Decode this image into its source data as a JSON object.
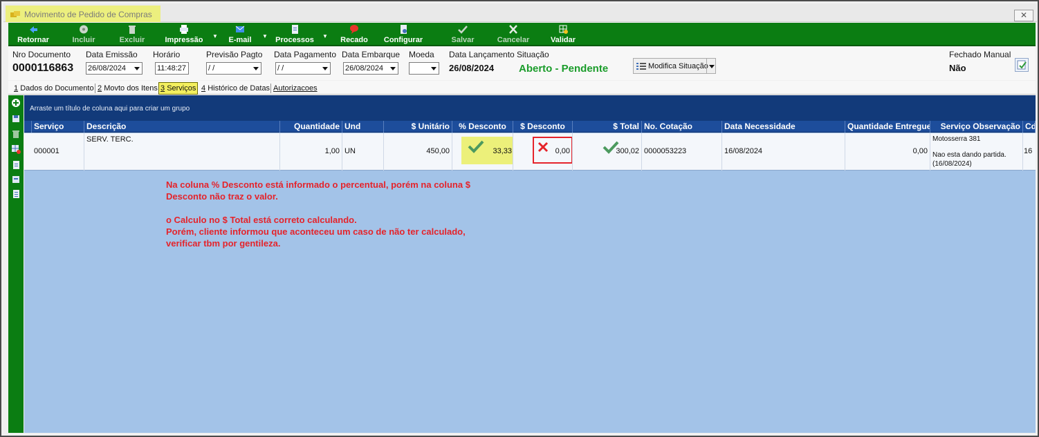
{
  "window": {
    "title": "Movimento de Pedido de Compras",
    "close": "✕"
  },
  "toolbar": {
    "items": [
      {
        "label": "Retornar",
        "icon": "back-arrow-icon",
        "enabled": true
      },
      {
        "label": "Incluir",
        "icon": "disc-plus-icon",
        "enabled": false
      },
      {
        "label": "Excluir",
        "icon": "trash-icon",
        "enabled": false
      },
      {
        "label": "Impressão",
        "icon": "printer-icon",
        "enabled": true,
        "dropdown": true
      },
      {
        "label": "E-mail",
        "icon": "envelope-icon",
        "enabled": true,
        "dropdown": true
      },
      {
        "label": "Processos",
        "icon": "document-icon",
        "enabled": true,
        "dropdown": true
      },
      {
        "label": "Recado",
        "icon": "red-balloon-icon",
        "enabled": true
      },
      {
        "label": "Configurar",
        "icon": "document-gear-icon",
        "enabled": true
      },
      {
        "label": "Salvar",
        "icon": "check-icon",
        "enabled": false
      },
      {
        "label": "Cancelar",
        "icon": "x-icon",
        "enabled": false
      },
      {
        "label": "Validar",
        "icon": "grid-check-icon",
        "enabled": true
      }
    ]
  },
  "header": {
    "nro_documento": {
      "label": "Nro Documento",
      "value": "0000116863"
    },
    "data_emissao": {
      "label": "Data Emissão",
      "value": "26/08/2024"
    },
    "horario": {
      "label": "Horário",
      "value": "11:48:27"
    },
    "previsao_pagto": {
      "label": "Previsão Pagto",
      "value": " / /"
    },
    "data_pagamento": {
      "label": "Data Pagamento",
      "value": " / /"
    },
    "data_embarque": {
      "label": "Data Embarque",
      "value": "26/08/2024"
    },
    "moeda": {
      "label": "Moeda",
      "value": ""
    },
    "data_lancamento": {
      "label": "Data Lançamento",
      "value": "26/08/2024"
    },
    "situacao": {
      "label": "Situação",
      "value": "Aberto - Pendente"
    },
    "modifica_situacao": "Modifica Situação",
    "fechado_manual": {
      "label": "Fechado Manual",
      "value": "Não"
    }
  },
  "tabs": [
    {
      "num": "1",
      "label": "Dados do Documento",
      "selected": false
    },
    {
      "num": "2",
      "label": "Movto dos Itens",
      "selected": false
    },
    {
      "num": "3",
      "label": "Serviços",
      "selected": true
    },
    {
      "num": "4",
      "label": "Histórico de Datas",
      "selected": false
    },
    {
      "num": "",
      "label": "Autorizacoes",
      "selected": false
    }
  ],
  "grid": {
    "group_hint": "Arraste um título de coluna aqui para criar um grupo",
    "columns": [
      "Serviço",
      "Descrição",
      "Quantidade",
      "Und",
      "$ Unitário",
      "% Desconto",
      "$ Desconto",
      "$ Total",
      "No. Cotação",
      "Data Necessidade",
      "Quantidade Entregue",
      "Serviço Observação",
      "Cd"
    ],
    "row": {
      "servico": "000001",
      "descricao": "SERV. TERC.",
      "quantidade": "1,00",
      "und": "UN",
      "unitario": "450,00",
      "pct_desconto": "33,33",
      "val_desconto": "0,00",
      "total": "300,02",
      "cotacao": "0000053223",
      "data_necessidade": "16/08/2024",
      "qtd_entregue": "0,00",
      "obs_line1": "Motosserra 381",
      "obs_line2": "Nao esta dando partida.",
      "obs_line3": "(16/08/2024)",
      "cd": "16"
    }
  },
  "annotation": {
    "line1": "Na coluna % Desconto está informado o percentual, porém na coluna $",
    "line2": "Desconto não traz o valor.",
    "line3": "o Calculo no $ Total está correto calculando.",
    "line4": "Porém, cliente informou que aconteceu um caso de não ter calculado,",
    "line5": "verificar tbm por gentileza."
  },
  "colors": {
    "toolbar": "#0b7d12",
    "grid_bg": "#a3c3e8",
    "header_row": "#1d4d9b",
    "group_bar": "#123a7a",
    "annotation": "#e5232a",
    "highlight": "#f3ef5e"
  }
}
